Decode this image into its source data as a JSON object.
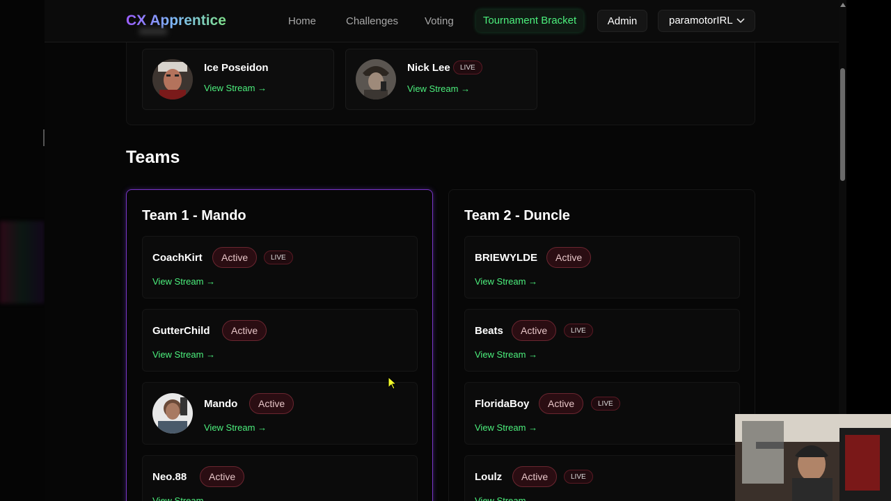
{
  "nav": {
    "brand": "CX Apprentice",
    "links": [
      "Home",
      "Challenges",
      "Voting"
    ],
    "active": "Tournament Bracket",
    "admin": "Admin",
    "user": "paramotorIRL"
  },
  "streamers": [
    {
      "name": "Ice Poseidon",
      "view": "View Stream →",
      "live": ""
    },
    {
      "name": "Nick Lee",
      "view": "View Stream →",
      "live": "LIVE"
    }
  ],
  "teams_heading": "Teams",
  "teams": [
    {
      "title": "Team 1 - Mando",
      "members": [
        {
          "name": "CoachKirt",
          "status": "Active",
          "live": "LIVE",
          "view": "View Stream →"
        },
        {
          "name": "GutterChild",
          "status": "Active",
          "live": "",
          "view": "View Stream →"
        },
        {
          "name": "Mando",
          "status": "Active",
          "live": "",
          "view": "View Stream →"
        },
        {
          "name": "Neo.88",
          "status": "Active",
          "live": "",
          "view": "View Stream →"
        }
      ]
    },
    {
      "title": "Team 2 - Duncle",
      "members": [
        {
          "name": "BRIEWYLDE",
          "status": "Active",
          "live": "",
          "view": "View Stream →"
        },
        {
          "name": "Beats",
          "status": "Active",
          "live": "LIVE",
          "view": "View Stream →"
        },
        {
          "name": "FloridaBoy",
          "status": "Active",
          "live": "LIVE",
          "view": "View Stream →"
        },
        {
          "name": "Loulz",
          "status": "Active",
          "live": "LIVE",
          "view": "View Stream →"
        }
      ]
    }
  ],
  "colors": {
    "accent_green": "#4cf07d",
    "team_border": "#7a35c9",
    "badge_bg": "#2a0d12"
  },
  "icons": [
    "chevron-down-icon",
    "cursor-icon"
  ]
}
